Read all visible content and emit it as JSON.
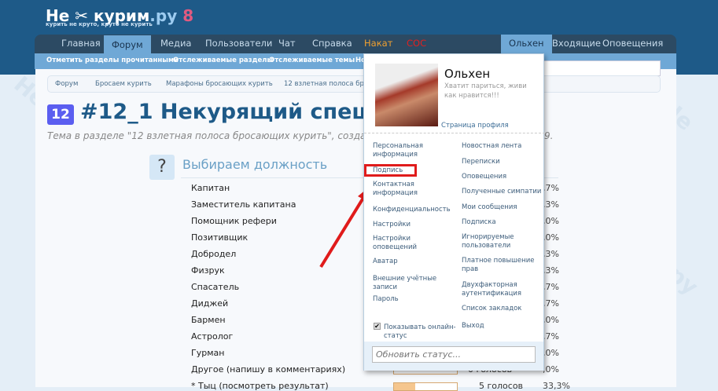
{
  "logo": {
    "name": "Не",
    "name2": "курим",
    "tld": ".ру",
    "tagline": "курить не круто, круто не курить"
  },
  "nav": {
    "tabs": [
      "Главная",
      "Форум",
      "Медиа",
      "Пользователи",
      "Чат",
      "Справка",
      "Накат",
      "СОС"
    ],
    "user_tabs": [
      "Ольхен",
      "Входящие",
      "Оповещения"
    ]
  },
  "subnav": [
    "Отметить разделы прочитанными",
    "Отслеживаемые разделы",
    "Отслеживаемые темы",
    "Но"
  ],
  "breadcrumbs": [
    "Форум",
    "Бросаем курить",
    "Марафоны бросающих курить",
    "12 взлетная полоса бр"
  ],
  "thread": {
    "badge": "12",
    "title": "#12_1 Некурящий спецназ",
    "subtitle": "Тема в разделе \"12 взлетная полоса бросающих курить\", создана п",
    "subtitle_end": "9."
  },
  "poll": {
    "icon": "?",
    "title": "Выбираем должность",
    "options": [
      {
        "label": "Капитан",
        "pct": ",7%"
      },
      {
        "label": "Заместитель капитана",
        "pct": ",3%"
      },
      {
        "label": "Помощник рефери",
        "pct": ",0%"
      },
      {
        "label": "Позитивщик",
        "pct": ",0%"
      },
      {
        "label": "Добродел",
        "pct": ",3%"
      },
      {
        "label": "Физрук",
        "pct": ",3%"
      },
      {
        "label": "Спасатель",
        "pct": ",7%"
      },
      {
        "label": "Диджей",
        "pct": ",7%"
      },
      {
        "label": "Бармен",
        "pct": ",0%"
      },
      {
        "label": "Астролог",
        "pct": ",7%"
      },
      {
        "label": "Гурман",
        "pct": ",0%"
      },
      {
        "label": "Другое (напишу в комментариях)",
        "pct": ",0%",
        "votes": "0 голосов",
        "fill": 0
      },
      {
        "label": "* Тыц (посмотреть результат)",
        "pct": "33,3%",
        "votes": "5 голосов",
        "fill": 33.3
      }
    ]
  },
  "popup": {
    "name": "Ольхен",
    "status": "Хватит париться, живи как нравится!!!",
    "profile_link": "Страница профиля",
    "left": [
      "Персональная информация",
      "Подпись",
      "Контактная информация",
      "Конфиденциальность",
      "Настройки",
      "Настройки оповещений",
      "Аватар",
      "Внешние учётные записи",
      "Пароль"
    ],
    "right": [
      "Новостная лента",
      "Переписки",
      "Оповещения",
      "Полученные симпатии",
      "Мои сообщения",
      "Подписка",
      "Игнорируемые пользователи",
      "Платное повышение прав",
      "Двухфакторная аутентификация",
      "Список закладок",
      "Выход"
    ],
    "show_online": "Показывать онлайн-статус",
    "show_online_checked": true,
    "status_placeholder": "Обновить статус...",
    "highlighted": "Подпись"
  },
  "colors": {
    "header": "#1e5a88",
    "highlight": "#e01b1b",
    "nakat": "#f0a030",
    "sos": "#e02020"
  }
}
